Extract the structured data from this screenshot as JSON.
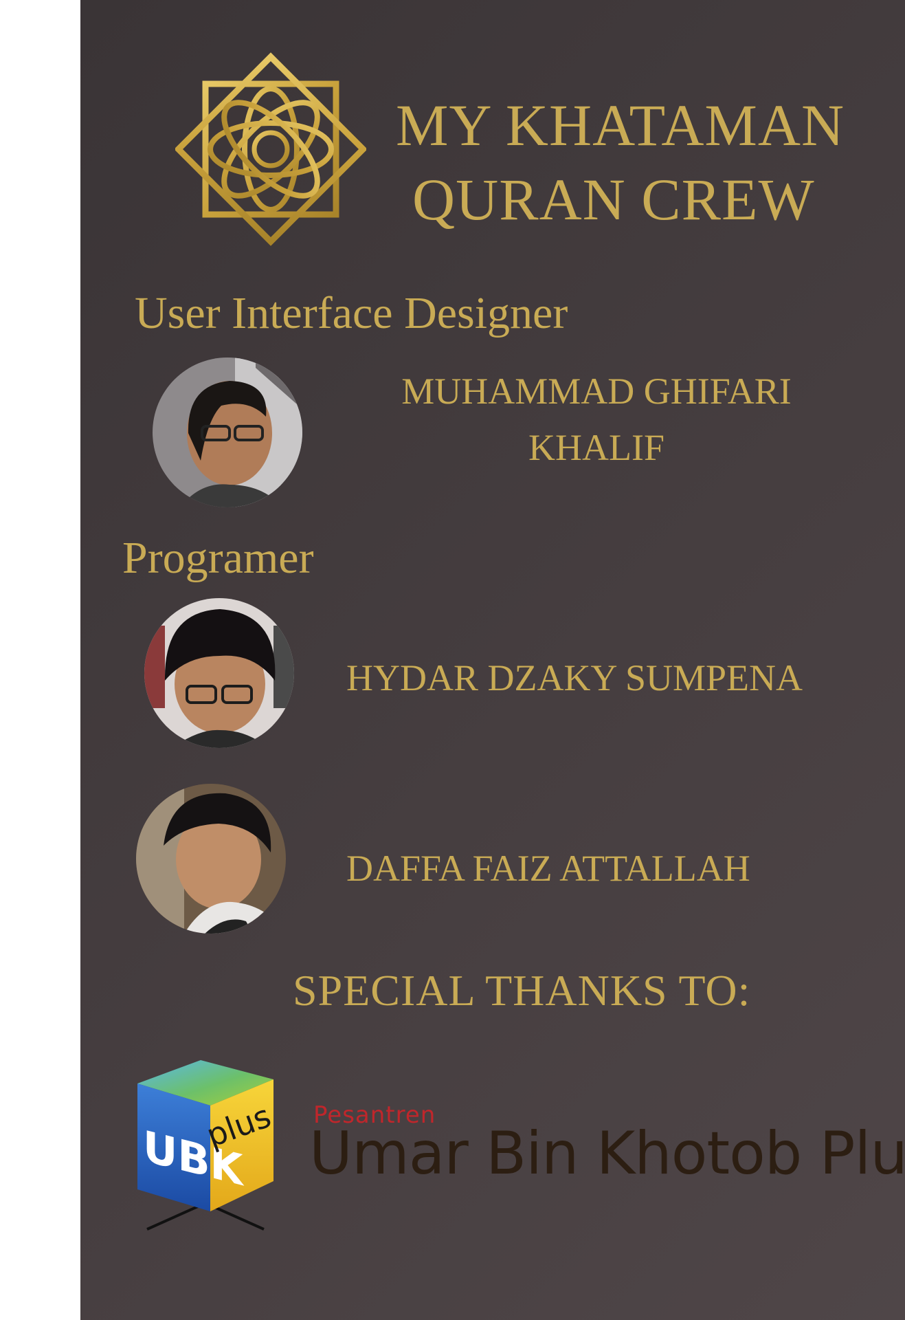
{
  "header": {
    "title_line1": "MY KHATAMAN",
    "title_line2": "QURAN CREW",
    "logo_icon": "octagram-flower-icon"
  },
  "roles": {
    "ui_designer": "User Interface Designer",
    "programmer": "Programer"
  },
  "crew": [
    {
      "name_line1": "MUHAMMAD GHIFARI",
      "name_line2": "KHALIF",
      "avatar_icon": "person-photo-icon"
    },
    {
      "name_line1": "HYDAR DZAKY  SUMPENA",
      "avatar_icon": "person-photo-icon"
    },
    {
      "name_line1": "DAFFA FAIZ ATTALLAH",
      "avatar_icon": "person-photo-icon"
    }
  ],
  "thanks": {
    "heading": "SPECIAL THANKS TO:",
    "logo_text_ubk": "UBK",
    "logo_text_plus": "plus",
    "org_prefix": "Pesantren",
    "org_name": "Umar Bin Khotob Plus"
  },
  "colors": {
    "gold": "#c9ab55",
    "background": "#423a3c",
    "red": "#c0262b",
    "dark_brown": "#2c1e12"
  }
}
